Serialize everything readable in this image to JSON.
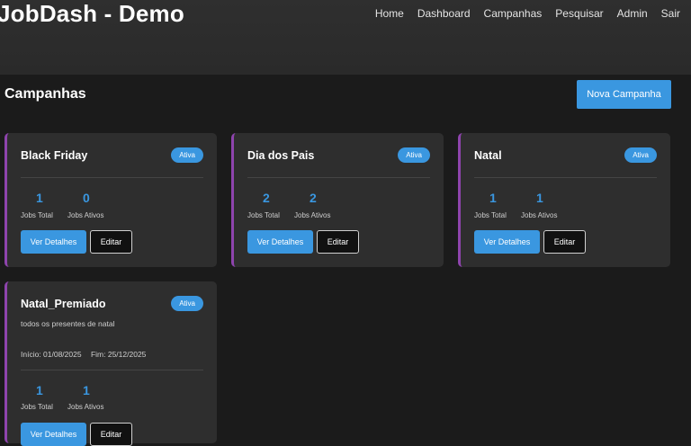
{
  "app": {
    "title": "JobDash - Demo"
  },
  "nav": [
    "Home",
    "Dashboard",
    "Campanhas",
    "Pesquisar",
    "Admin",
    "Sair"
  ],
  "page": {
    "title": "Campanhas",
    "new_button": "Nova Campanha"
  },
  "labels": {
    "jobs_total": "Jobs Total",
    "jobs_active": "Jobs Ativos",
    "details": "Ver Detalhes",
    "edit": "Editar"
  },
  "campaigns": [
    {
      "name": "Black Friday",
      "status": "Ativa",
      "jobs_total": "1",
      "jobs_active": "0"
    },
    {
      "name": "Dia dos Pais",
      "status": "Ativa",
      "jobs_total": "2",
      "jobs_active": "2"
    },
    {
      "name": "Natal",
      "status": "Ativa",
      "jobs_total": "1",
      "jobs_active": "1"
    },
    {
      "name": "Natal_Premiado",
      "status": "Ativa",
      "description": "todos os presentes de natal",
      "start": "Início: 01/08/2025",
      "end": "Fim: 25/12/2025",
      "jobs_total": "1",
      "jobs_active": "1"
    }
  ],
  "colors": {
    "accent": "#3a97e0",
    "card_border": "#8e44ad",
    "background": "#1b1b1b",
    "card": "#2e2e2e"
  }
}
